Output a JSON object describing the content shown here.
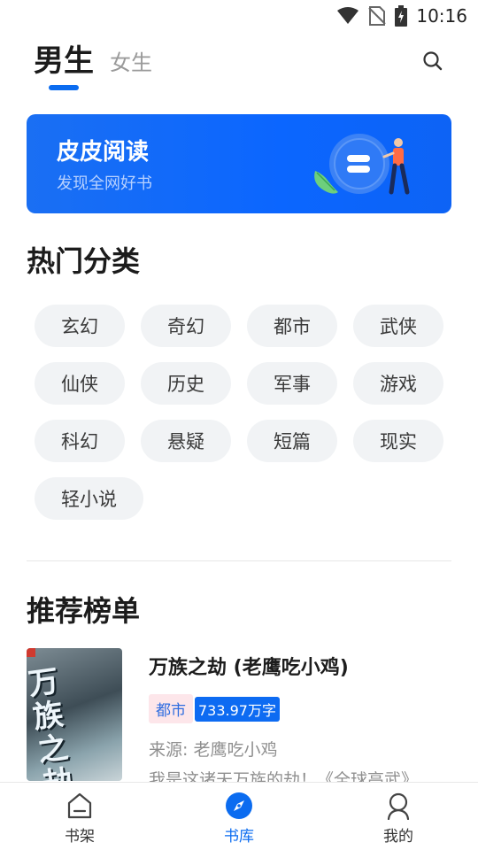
{
  "status_bar": {
    "time": "10:16"
  },
  "header": {
    "tabs": [
      {
        "label": "男生",
        "active": true
      },
      {
        "label": "女生",
        "active": false
      }
    ]
  },
  "banner": {
    "title": "皮皮阅读",
    "subtitle": "发现全网好书"
  },
  "hot_categories": {
    "title": "热门分类",
    "items": [
      "玄幻",
      "奇幻",
      "都市",
      "武侠",
      "仙侠",
      "历史",
      "军事",
      "游戏",
      "科幻",
      "悬疑",
      "短篇",
      "现实",
      "轻小说"
    ]
  },
  "ranking": {
    "title": "推荐榜单",
    "books": [
      {
        "title": "万族之劫 (老鹰吃小鸡)",
        "cover_text": "万族之劫",
        "genre": "都市",
        "word_count": "733.97万字",
        "source": "来源: 老鹰吃小鸡",
        "description": "我是这诸天万族的劫！《全球高武》"
      }
    ]
  },
  "bottom_nav": {
    "items": [
      {
        "label": "书架",
        "icon": "bookshelf-icon",
        "active": false
      },
      {
        "label": "书库",
        "icon": "compass-icon",
        "active": true
      },
      {
        "label": "我的",
        "icon": "person-icon",
        "active": false
      }
    ]
  },
  "colors": {
    "accent": "#0b6cf0",
    "chip_bg": "#f1f3f5"
  }
}
